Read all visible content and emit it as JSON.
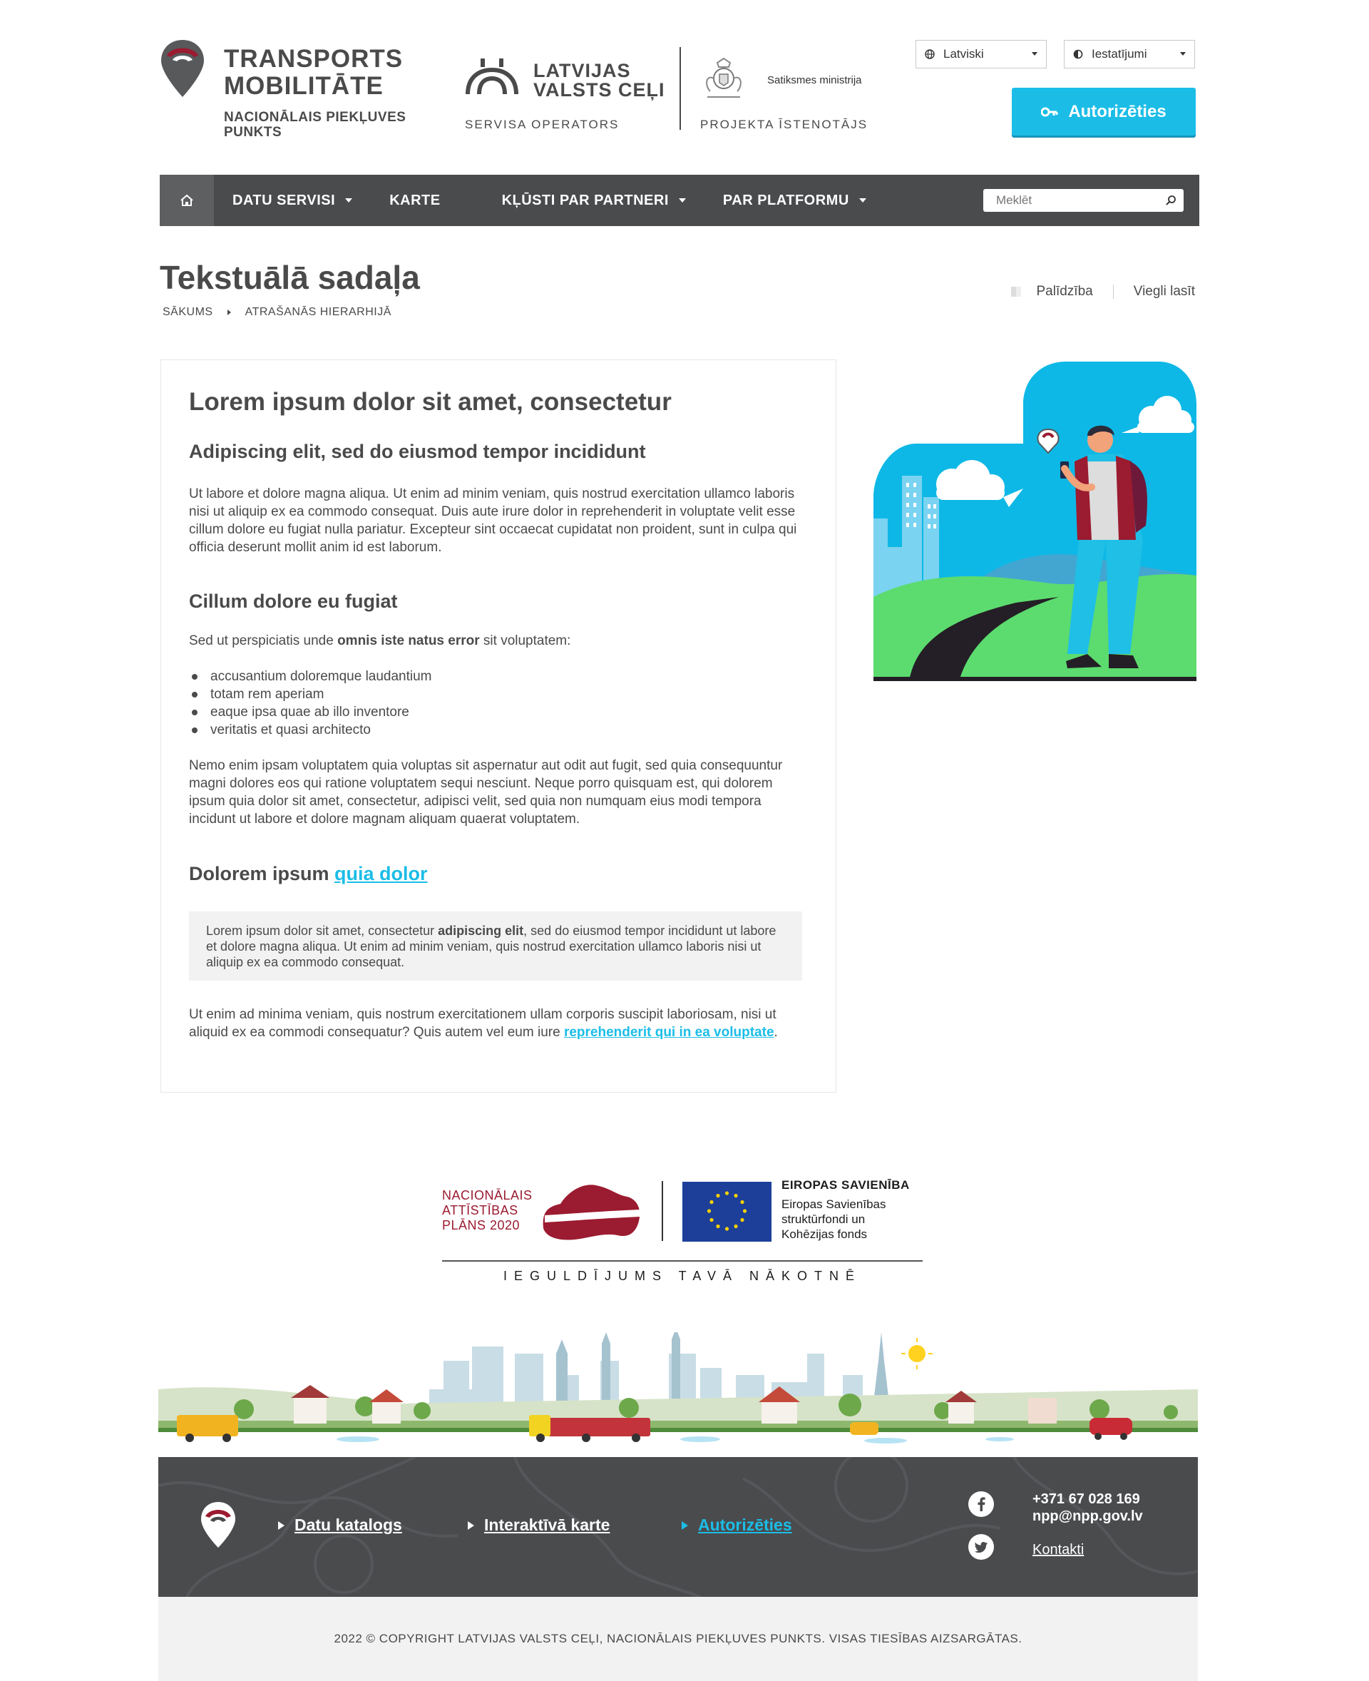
{
  "header": {
    "brand_title_line1": "TRANSPORTS",
    "brand_title_line2": "MOBILITĀTE",
    "brand_sub_line1": "NACIONĀLAIS PIEKĻUVES",
    "brand_sub_line2": "PUNKTS",
    "operator_title_line1": "LATVIJAS",
    "operator_title_line2": "VALSTS CEĻI",
    "operator_role": "SERVISA OPERATORS",
    "ministry_name": "Satiksmes ministrija",
    "ministry_role": "PROJEKTA ĪSTENOTĀJS",
    "language_select": "Latviski",
    "settings_select": "Iestatījumi",
    "auth_button": "Autorizēties"
  },
  "nav": {
    "home_icon": "home-icon",
    "items": [
      {
        "label": "DATU SERVISI",
        "has_dropdown": true
      },
      {
        "label": "KARTE",
        "has_dropdown": false
      },
      {
        "label": "KĻŪSTI PAR PARTNERI",
        "has_dropdown": true
      },
      {
        "label": "PAR PLATFORMU",
        "has_dropdown": true
      }
    ],
    "search_placeholder": "Meklēt"
  },
  "page": {
    "title": "Tekstuālā sadaļa",
    "breadcrumb": [
      "SĀKUMS",
      "ATRAŠANĀS HIERARHIJĀ"
    ],
    "tools": {
      "help": "Palīdzība",
      "easy_read": "Viegli lasīt"
    }
  },
  "article": {
    "h1": "Lorem ipsum dolor sit amet, consectetur",
    "h2a": "Adipiscing elit, sed do eiusmod tempor incididunt",
    "p1": "Ut labore et dolore magna aliqua. Ut enim ad minim veniam, quis nostrud exercitation ullamco laboris nisi ut aliquip ex ea commodo consequat. Duis aute irure dolor in reprehenderit in voluptate velit esse cillum dolore eu fugiat nulla pariatur. Excepteur sint occaecat cupidatat non proident, sunt in culpa qui officia deserunt mollit anim id est laborum.",
    "h2b": "Cillum dolore eu fugiat",
    "p2_before": "Sed ut perspiciatis unde ",
    "p2_bold": "omnis iste natus error",
    "p2_after": " sit voluptatem:",
    "list": [
      "accusantium doloremque laudantium",
      "totam rem aperiam",
      "eaque ipsa quae ab illo inventore",
      "veritatis et quasi architecto"
    ],
    "p3": "Nemo enim ipsam voluptatem quia voluptas sit aspernatur aut odit aut fugit, sed quia consequuntur magni dolores eos qui ratione voluptatem sequi nesciunt. Neque porro quisquam est, qui dolorem ipsum quia dolor sit amet, consectetur, adipisci velit, sed quia non numquam eius modi tempora incidunt ut labore et dolore magnam aliquam quaerat voluptatem.",
    "h2c_text": "Dolorem ipsum ",
    "h2c_link": "quia dolor",
    "quote_before": "Lorem ipsum dolor sit amet, consectetur ",
    "quote_bold": "adipiscing elit",
    "quote_after": ", sed do eiusmod tempor incididunt ut labore et dolore magna aliqua. Ut enim ad minim veniam, quis nostrud exercitation ullamco laboris nisi ut aliquip ex ea commodo consequat.",
    "p4_text": "Ut enim ad minima veniam, quis nostrum exercitationem ullam corporis suscipit laboriosam, nisi ut aliquid ex ea commodi consequatur? Quis autem vel eum iure ",
    "p4_link": "reprehenderit qui in ea voluptate",
    "p4_end": "."
  },
  "funding": {
    "nap_line1": "NACIONĀLAIS",
    "nap_line2": "ATTĪSTĪBAS",
    "nap_line3": "PLĀNS 2020",
    "eu_title": "EIROPAS SAVIENĪBA",
    "eu_line1": "Eiropas Savienības",
    "eu_line2": "struktūrfondi un",
    "eu_line3": "Kohēzijas fonds",
    "slogan": "IEGULDĪJUMS TAVĀ NĀKOTNĒ"
  },
  "footer": {
    "links": [
      {
        "label": "Datu katalogs",
        "active": false
      },
      {
        "label": "Interaktīvā karte",
        "active": false
      },
      {
        "label": "Autorizēties",
        "active": true
      }
    ],
    "phone": "+371 67 028 169",
    "email": "npp@npp.gov.lv",
    "contacts_link": "Kontakti",
    "social": [
      "facebook-icon",
      "twitter-icon"
    ],
    "copyright": "2022 © COPYRIGHT LATVIJAS VALSTS CEĻI, NACIONĀLAIS PIEKĻUVES PUNKTS. VISAS TIESĪBAS AIZSARGĀTAS."
  },
  "colors": {
    "accent": "#1bbde7",
    "nav_bg": "#4a4b4d",
    "brand_red": "#9b1b30",
    "text": "#4a4a4a"
  }
}
